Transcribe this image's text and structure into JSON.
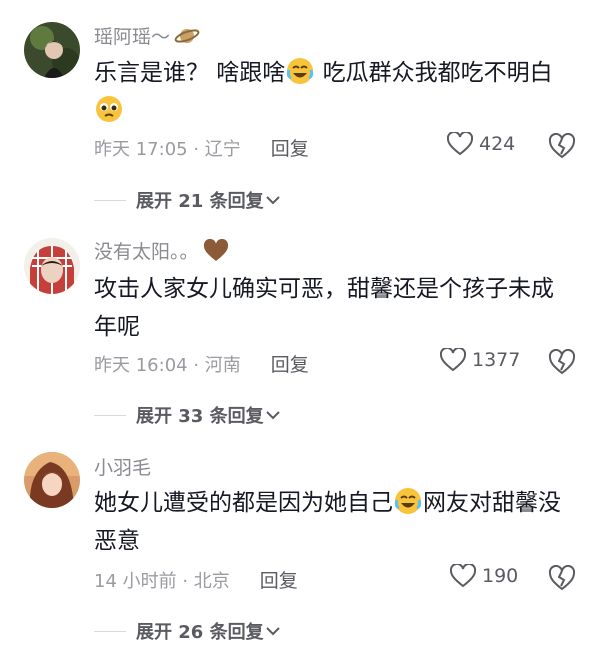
{
  "comments": [
    {
      "username": "瑶阿瑶～",
      "text_before": "乐言是谁？ 啥跟啥",
      "text_after": " 吃瓜群众我都吃不明白",
      "time": "昨天 17:05 · 辽宁",
      "reply_label": "回复",
      "likes": "424",
      "expand_label": "展开 21 条回复"
    },
    {
      "username": "没有太阳。。",
      "text": "攻击人家女儿确实可恶，甜馨还是个孩子未成年呢",
      "time": "昨天 16:04 · 河南",
      "reply_label": "回复",
      "likes": "1377",
      "expand_label": "展开 33 条回复"
    },
    {
      "username": "小羽毛",
      "text_before": "她女儿遭受的都是因为她自己",
      "text_after": "网友对甜馨没恶意",
      "time": "14 小时前 · 北京",
      "reply_label": "回复",
      "likes": "190",
      "expand_label": "展开 26 条回复"
    }
  ],
  "icons": {
    "planet": "saturn-planet-emoji",
    "heart_brown": "brown-heart-emoji",
    "crying": "crying-laughing-emoji",
    "pleading": "pleading-face-emoji",
    "like": "heart-outline-icon",
    "dislike": "broken-heart-outline-icon",
    "chevron": "chevron-down-icon"
  },
  "colors": {
    "username": "#8a8b91",
    "text": "#161823",
    "meta": "#9a9ba1"
  }
}
